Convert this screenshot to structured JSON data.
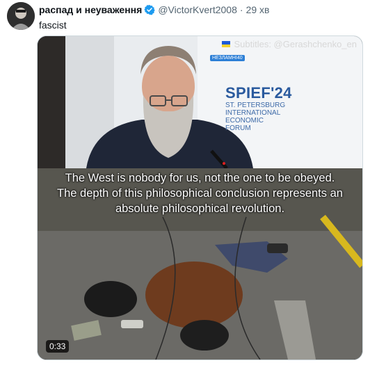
{
  "author": {
    "display_name": "распад и неуваження",
    "handle": "@VictorKvert2008",
    "separator": "·",
    "timestamp": "29 хв",
    "verified_icon": "verified-badge-icon"
  },
  "tweet": {
    "text": "fascist"
  },
  "media": {
    "type": "video",
    "subtitle_credit": "Subtitles: @Gerashchenko_en",
    "channel_badge": "НЕЗЛАМНІ40",
    "forum_title": "SPIEF'24",
    "forum_lines": [
      "ST. PETERSBURG",
      "INTERNATIONAL",
      "ECONOMIC",
      "FORUM"
    ],
    "caption_lines": [
      "The West is nobody for us, not the one to be obeyed.",
      "The depth of this philosophical conclusion represents an",
      "absolute philosophical revolution."
    ],
    "duration": "0:33"
  },
  "colors": {
    "verified": "#1d9bf0",
    "forum_blue": "#2a5a9e",
    "text_primary": "#0f1419",
    "text_secondary": "#536471"
  }
}
